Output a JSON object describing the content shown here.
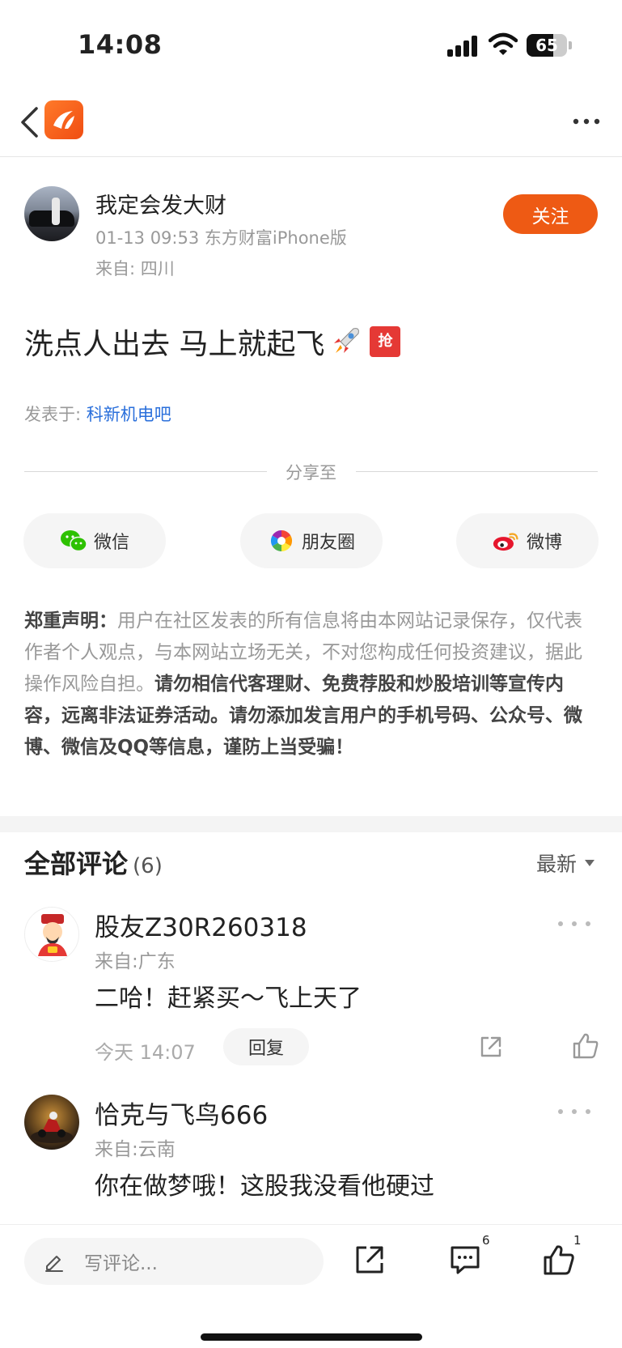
{
  "status_bar": {
    "time": "14:08",
    "battery": "65",
    "battery_level": 0.65
  },
  "nav": {
    "back_icon": "chevron-left-icon",
    "logo_icon": "eastmoney-logo-icon",
    "more_icon": "more-dots-icon"
  },
  "author": {
    "name": "我定会发大财",
    "meta": "01-13 09:53 东方财富iPhone版",
    "location": "来自: 四川",
    "follow_label": "关注"
  },
  "post": {
    "text": "洗点人出去 马上就起飞",
    "emoji_badge": "抢",
    "posted_in_label": "发表于: ",
    "posted_in_bar": "科新机电吧"
  },
  "share": {
    "label": "分享至",
    "targets": [
      {
        "label": "微信",
        "icon": "wechat-icon"
      },
      {
        "label": "朋友圈",
        "icon": "moments-icon"
      },
      {
        "label": "微博",
        "icon": "weibo-icon"
      }
    ]
  },
  "disclaimer": {
    "title": "郑重声明：",
    "normal": "用户在社区发表的所有信息将由本网站记录保存，仅代表作者个人观点，与本网站立场无关，不对您构成任何投资建议，据此操作风险自担。",
    "bold": "请勿相信代客理财、免费荐股和炒股培训等宣传内容，远离非法证券活动。请勿添加发言用户的手机号码、公众号、微博、微信及QQ等信息，谨防上当受骗！"
  },
  "comments": {
    "title": "全部评论",
    "count": "(6)",
    "sort_label": "最新",
    "items": [
      {
        "name": "股友Z30R260318",
        "location": "来自:广东",
        "text": "二哈！赶紧买～飞上天了",
        "time": "今天 14:07",
        "reply_label": "回复"
      },
      {
        "name": "恰克与飞鸟666",
        "location": "来自:云南",
        "text": "你在做梦哦！这股我没看他硬过"
      }
    ]
  },
  "bottom_bar": {
    "input_placeholder": "写评论...",
    "comment_count": "6",
    "like_count": "1"
  },
  "colors": {
    "accent": "#ee5a14",
    "link": "#2a6fdb",
    "muted": "#999999"
  }
}
